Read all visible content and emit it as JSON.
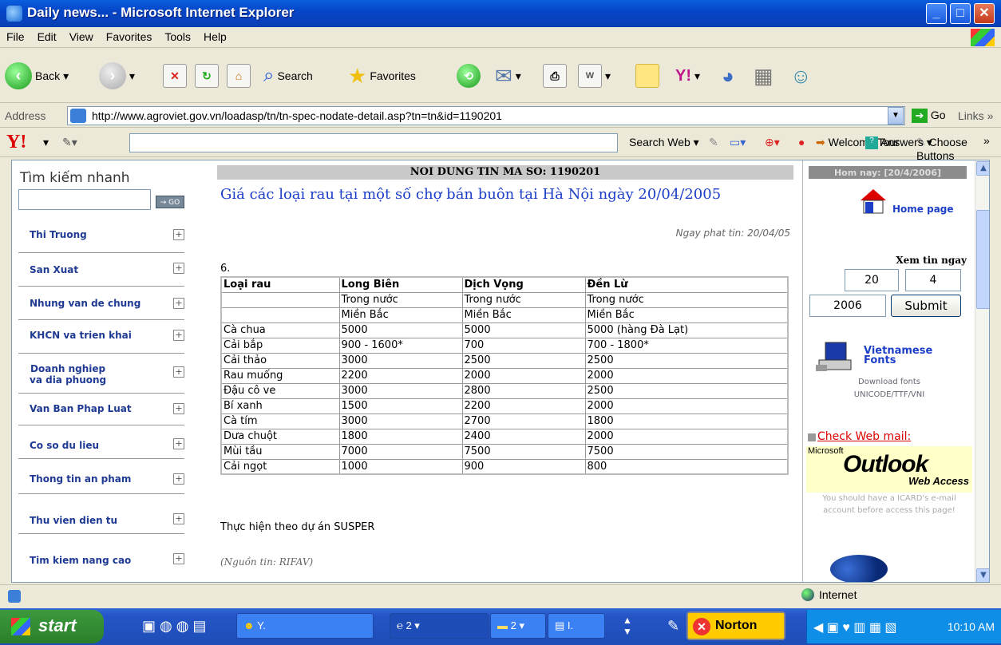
{
  "window": {
    "title": "Daily news... - Microsoft Internet Explorer",
    "min": "_",
    "max": "□",
    "close": "✕"
  },
  "menu": [
    "File",
    "Edit",
    "View",
    "Favorites",
    "Tools",
    "Help"
  ],
  "toolbar": {
    "back": "Back",
    "search": "Search",
    "favorites": "Favorites"
  },
  "address": {
    "label": "Address",
    "url": "http://www.agroviet.gov.vn/loadasp/tn/tn-spec-nodate-detail.asp?tn=tn&id=1190201",
    "go": "Go",
    "links": "Links"
  },
  "yahoo": {
    "logo": "Y!",
    "search_web": "Search Web",
    "welcome": "Welcome Tour",
    "choose": "Choose Buttons",
    "answers": "Answers"
  },
  "left": {
    "quick_search": "Tìm kiếm nhanh",
    "go": "→ GO",
    "items": [
      "Thi Truong",
      "San Xuat",
      "Nhung van de chung",
      "KHCN va trien khai",
      "Doanh nghiep\nva dia phuong",
      "Van Ban Phap Luat",
      "Co so du lieu",
      "Thong tin an pham",
      "Thu vien dien tu",
      "Tim kiem nang cao"
    ]
  },
  "article": {
    "header": "NOI DUNG TIN MA SO: 1190201",
    "title": "Giá các loại rau tại một số chợ bán buôn tại Hà Nội ngày 20/04/2005",
    "date": "Ngay phat tin: 20/04/05",
    "number": "6.",
    "table": {
      "head": [
        "Loại rau",
        "Long Biên",
        "Dịch Vọng",
        "Đền Lừ"
      ],
      "sub1": [
        "",
        "Trong nước",
        "Trong nước",
        "Trong nước"
      ],
      "sub2": [
        "",
        "Miền Bắc",
        "Miền Bắc",
        "Miền Bắc"
      ],
      "rows": [
        [
          "Cà chua",
          "5000",
          "5000",
          "5000 (hàng Đà Lạt)"
        ],
        [
          "Cải bắp",
          "900 - 1600*",
          "700",
          "700 - 1800*"
        ],
        [
          "Cải thảo",
          "3000",
          "2500",
          "2500"
        ],
        [
          "Rau muống",
          "2200",
          "2000",
          "2000"
        ],
        [
          "Đậu cô ve",
          "3000",
          "2800",
          "2500"
        ],
        [
          "Bí xanh",
          "1500",
          "2200",
          "2000"
        ],
        [
          "Cà tím",
          "3000",
          "2700",
          "1800"
        ],
        [
          "Dưa chuột",
          "1800",
          "2400",
          "2000"
        ],
        [
          "Mùi tầu",
          "7000",
          "7500",
          "7500"
        ],
        [
          "Cải ngọt",
          "1000",
          "900",
          "800"
        ]
      ]
    },
    "note": "Thực hiện theo dự án SUSPER",
    "source": "(Nguồn tin: RIFAV)"
  },
  "right": {
    "today": "Hom nay: [20/4/2006]",
    "home": "Home page",
    "view_date": "Xem tin ngay",
    "day": "20",
    "month": "4",
    "year": "2006",
    "submit": "Submit",
    "fonts": "Vietnamese\nFonts",
    "download": "Download fonts\nUNICODE/TTF/VNI",
    "webmail": "Check Web mail:",
    "microsoft": "Microsoft",
    "outlook": "Outlook",
    "webaccess": "Web Access",
    "mail_note": "You should have a ICARD's e-mail account before access this page!"
  },
  "status": {
    "zone": "Internet"
  },
  "taskbar": {
    "start": "start",
    "b1": "Y.",
    "b2": "2",
    "b3": "2",
    "b4": "I.",
    "norton": "Norton",
    "clock": "10:10 AM"
  }
}
